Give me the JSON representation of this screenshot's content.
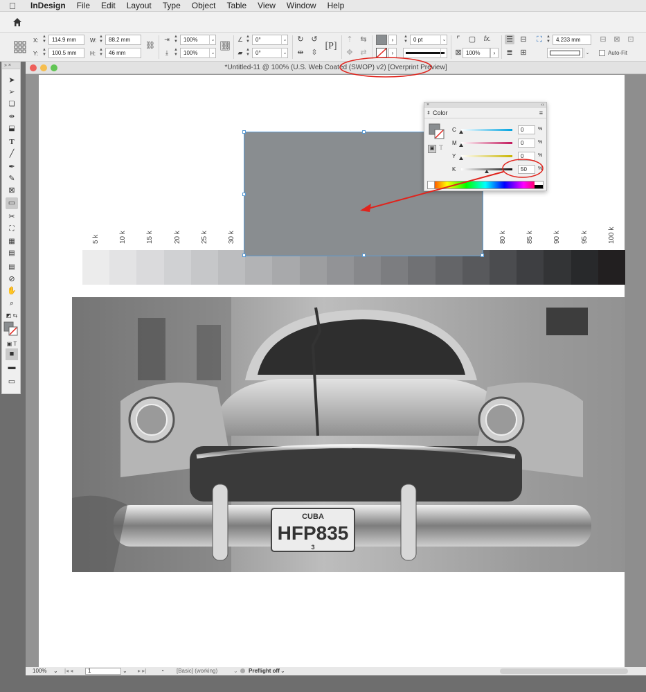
{
  "menubar": {
    "apple": "",
    "app": "InDesign",
    "items": [
      "File",
      "Edit",
      "Layout",
      "Type",
      "Object",
      "Table",
      "View",
      "Window",
      "Help"
    ]
  },
  "control_panel": {
    "x_label": "X:",
    "x_value": "114.9 mm",
    "y_label": "Y:",
    "y_value": "100.5 mm",
    "w_label": "W:",
    "w_value": "88.2 mm",
    "h_label": "H:",
    "h_value": "46 mm",
    "scale_x": "100%",
    "scale_y": "100%",
    "rotate": "0°",
    "shear": "0°",
    "stroke_weight": "0 pt",
    "opacity": "100%",
    "dimension": "4.233 mm",
    "auto_fit": "Auto-Fit",
    "fx": "fx."
  },
  "document": {
    "title": "*Untitled-11 @ 100% (U.S. Web Coated (SWOP) v2) [Overprint Preview]",
    "ramp_labels": [
      "5 k",
      "10 k",
      "15 k",
      "20 k",
      "25 k",
      "30 k",
      "",
      "",
      "",
      "",
      "",
      "",
      "",
      "",
      "",
      "80 k",
      "85 k",
      "90 k",
      "95 k",
      "100 k"
    ],
    "ramp_colors": [
      "#ececec",
      "#e3e3e4",
      "#dadadc",
      "#d0d1d3",
      "#c6c7c9",
      "#bcbdbf",
      "#b2b3b5",
      "#a8a9ab",
      "#9d9ea0",
      "#929396",
      "#87888b",
      "#7c7d80",
      "#707174",
      "#646568",
      "#58595c",
      "#4b4c4f",
      "#3e3f42",
      "#333436",
      "#28292b",
      "#221f20"
    ],
    "frame_fill": "#898d90",
    "plate_top": "CUBA",
    "plate_number": "HFP835",
    "plate_bottom": "3"
  },
  "color_panel": {
    "title": "Color",
    "channels": [
      {
        "label": "C",
        "value": "0",
        "unit": "%",
        "level": 0
      },
      {
        "label": "M",
        "value": "0",
        "unit": "%",
        "level": 0
      },
      {
        "label": "Y",
        "value": "0",
        "unit": "%",
        "level": 0
      },
      {
        "label": "K",
        "value": "50",
        "unit": "%",
        "level": 0.5
      }
    ]
  },
  "statusbar": {
    "zoom": "100%",
    "page": "1",
    "profile": "[Basic] (working)",
    "preflight": "Preflight off"
  },
  "colors": {
    "annotation": "#e0231c",
    "selection": "#5a9bd5"
  }
}
